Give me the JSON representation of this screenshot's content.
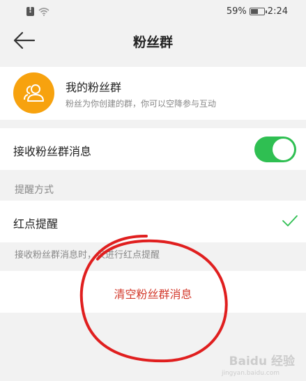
{
  "status_bar": {
    "battery_text": "59%",
    "time": "2:24",
    "battery_level": 0.59
  },
  "header": {
    "title": "粉丝群"
  },
  "group": {
    "name": "我的粉丝群",
    "description": "粉丝为你创建的群，你可以空降参与互动"
  },
  "receive": {
    "label": "接收粉丝群消息",
    "enabled": true
  },
  "reminder": {
    "section_label": "提醒方式",
    "option_label": "红点提醒",
    "hint": "接收粉丝群消息时，仅进行红点提醒"
  },
  "clear": {
    "label": "清空粉丝群消息"
  },
  "watermark": {
    "text": "Baidu 经验",
    "sub": "jingyan.baidu.com"
  },
  "colors": {
    "accent_green": "#2fbf52",
    "avatar_orange": "#f7a20e",
    "danger_red": "#d33a2c",
    "annotation_red": "#e01f1f"
  }
}
